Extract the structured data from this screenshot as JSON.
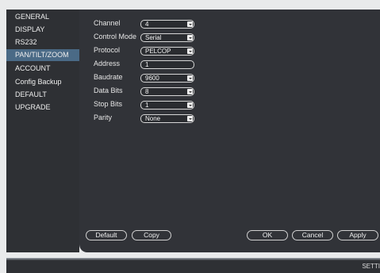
{
  "sidebar": {
    "items": [
      {
        "label": "GENERAL"
      },
      {
        "label": "DISPLAY"
      },
      {
        "label": "RS232"
      },
      {
        "label": "PAN/TILT/ZOOM",
        "active": true
      },
      {
        "label": "ACCOUNT"
      },
      {
        "label": "Config Backup"
      },
      {
        "label": "DEFAULT"
      },
      {
        "label": "UPGRADE"
      }
    ]
  },
  "form": {
    "channel": {
      "label": "Channel",
      "value": "4"
    },
    "control_mode": {
      "label": "Control Mode",
      "value": "Serial"
    },
    "protocol": {
      "label": "Protocol",
      "value": "PELCOP"
    },
    "address": {
      "label": "Address",
      "value": "1"
    },
    "baudrate": {
      "label": "Baudrate",
      "value": "9600"
    },
    "data_bits": {
      "label": "Data Bits",
      "value": "8"
    },
    "stop_bits": {
      "label": "Stop Bits",
      "value": "1"
    },
    "parity": {
      "label": "Parity",
      "value": "None"
    }
  },
  "buttons": {
    "default": "Default",
    "copy": "Copy",
    "ok": "OK",
    "cancel": "Cancel",
    "apply": "Apply"
  },
  "bottom_bar": {
    "label": "SETTI"
  },
  "colors": {
    "active_item": "#4a6a86",
    "panel_bg": "#313338",
    "page_bg": "#e9eaeb"
  }
}
